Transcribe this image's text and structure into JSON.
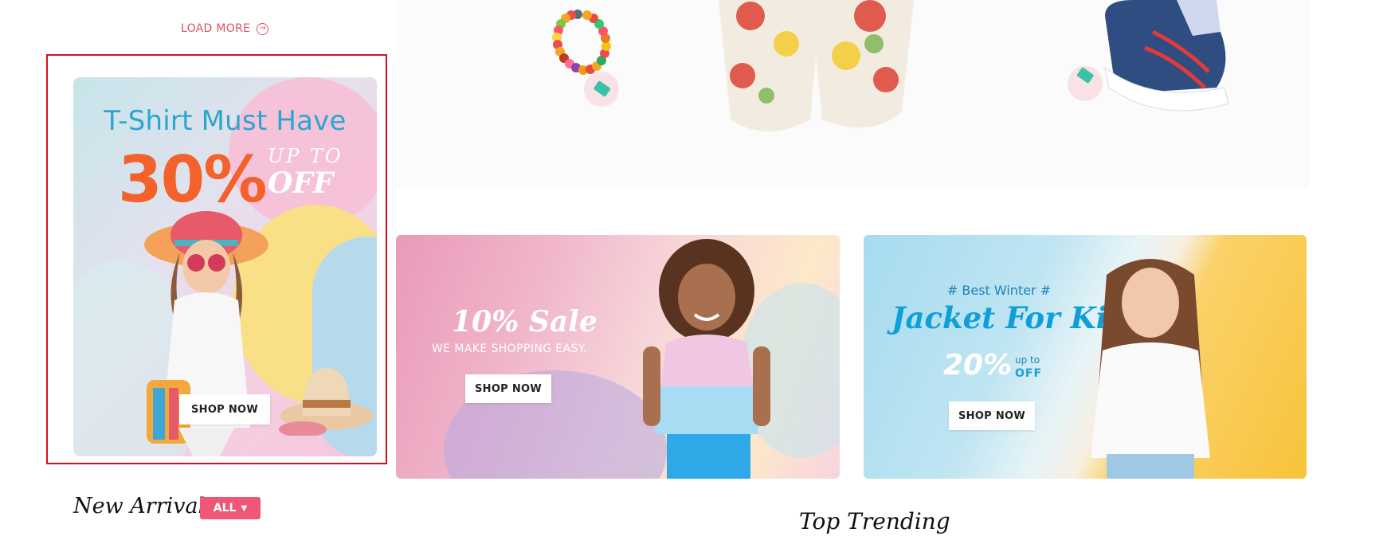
{
  "load_more": {
    "label": "LOAD MORE"
  },
  "promo_tall": {
    "heading": "T-Shirt Must Have",
    "discount": "30%",
    "up_to": "UP TO",
    "off": "OFF",
    "button": "SHOP NOW"
  },
  "banner_sale": {
    "title": "10% Sale",
    "subtitle": "WE MAKE SHOPPING EASY.",
    "button": "SHOP NOW"
  },
  "banner_winter": {
    "tagline": "# Best Winter #",
    "title": "Jacket For Kids",
    "discount": "20%",
    "up_to": "up to",
    "off": "OFF",
    "button": "SHOP NOW"
  },
  "sections": {
    "new_arrivals": "New Arrivals",
    "filter_all": "ALL",
    "top_trending": "Top Trending"
  },
  "colors": {
    "accent_pink": "#ef5776",
    "selection_red": "#d6101b",
    "promo_orange": "#f4622c",
    "promo_blue": "#2aa7cf"
  }
}
